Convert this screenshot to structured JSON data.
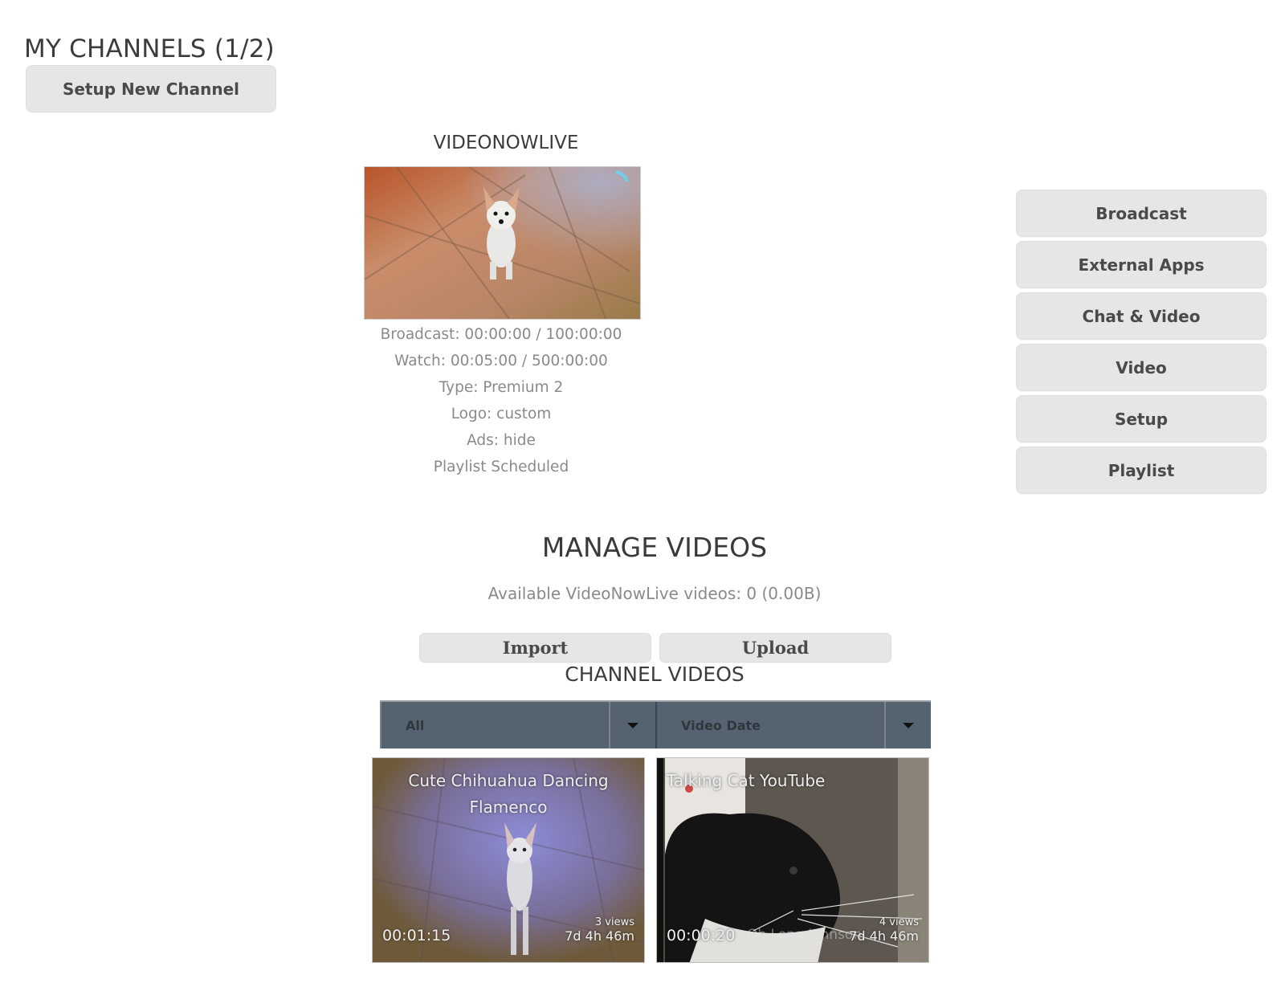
{
  "header": {
    "title": "MY CHANNELS (1/2)",
    "setup_new_channel_label": "Setup New Channel"
  },
  "channel": {
    "name": "VIDEONOWLIVE",
    "thumbnail_icon": "video-thumbnail-chihuahua",
    "stats": [
      "Broadcast: 00:00:00 / 100:00:00",
      "Watch: 00:05:00 / 500:00:00",
      "Type: Premium 2",
      "Logo: custom",
      "Ads: hide",
      "Playlist Scheduled"
    ]
  },
  "side_nav": {
    "items": [
      {
        "label": "Broadcast"
      },
      {
        "label": "External Apps"
      },
      {
        "label": "Chat & Video"
      },
      {
        "label": "Video"
      },
      {
        "label": "Setup"
      },
      {
        "label": "Playlist"
      }
    ]
  },
  "manage": {
    "title": "MANAGE VIDEOS",
    "available_text": "Available VideoNowLive videos: 0 (0.00B)",
    "import_label": "Import",
    "upload_label": "Upload",
    "channel_videos_title": "CHANNEL VIDEOS",
    "filter_select": {
      "value": "All"
    },
    "sort_select": {
      "value": "Video Date"
    }
  },
  "videos": [
    {
      "title": "Cute Chihuahua Dancing Flamenco",
      "duration": "00:01:15",
      "views": "3 views",
      "age": "7d 4h 46m",
      "overlay_text": ""
    },
    {
      "title": "Talking Cat YouTube",
      "duration": "00:00:20",
      "views": "4 views",
      "age": "7d 4h 46m",
      "overlay_text": "Oh Long Johnson"
    }
  ],
  "colors": {
    "button_bg": "#e6e6e6",
    "select_bg": "#556370",
    "text_dark": "#3c3c3c",
    "text_muted": "#8a8a8a"
  }
}
